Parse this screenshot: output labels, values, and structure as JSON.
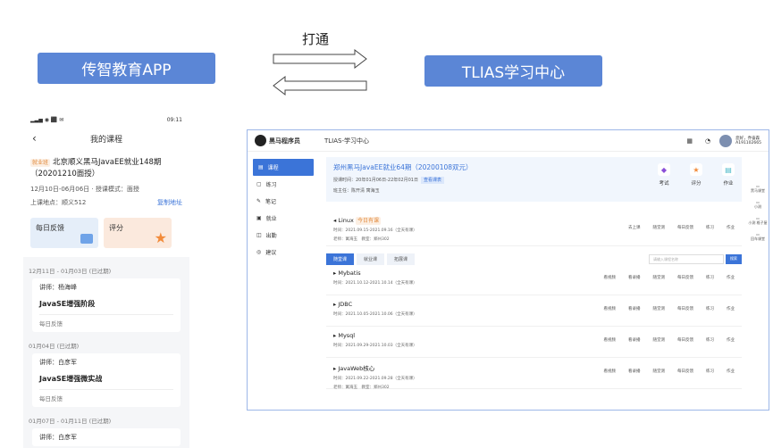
{
  "diagram": {
    "left_box": "传智教育APP",
    "right_box": "TLIAS学习中心",
    "arrow_label": "打通"
  },
  "phone": {
    "status_time": "09:11",
    "nav_title": "我的课程",
    "badge": "就业班",
    "course_title": "北京顺义黑马JavaEE就业148期（20201210面授）",
    "date_range": "12月10日-06月06日 · 授课模式：面授",
    "location": "上课地点：顺义512",
    "copy_link": "复制地址",
    "card1": "每日反馈",
    "card2": "评分",
    "sections": [
      {
        "date": "12月11日 - 01月03日 (已过期)",
        "teacher": "讲师：杨海峰",
        "name": "JavaSE增强阶段",
        "fb": "每日反馈"
      },
      {
        "date": "01月04日 (已过期)",
        "teacher": "讲师：白彦军",
        "name": "JavaSE增强微实战",
        "fb": "每日反馈"
      },
      {
        "date": "01月07日 - 01月11日 (已过期)",
        "teacher": "讲师：白彦军",
        "name": "",
        "fb": ""
      }
    ]
  },
  "web": {
    "logo": "黑马程序员",
    "title": "TLIAS-学习中心",
    "user": "您好，乔奋森",
    "user_id": "A191102665",
    "sidebar": [
      "课程",
      "练习",
      "笔记",
      "就业",
      "出勤",
      "建议"
    ],
    "hero": {
      "title": "郑州黑马JavaEE就业64期（20200108双元）",
      "time": "授课时间：20年01月06日-22年02月01日",
      "time_tag": "查看课表",
      "teacher": "班主任：陈开清 寓海玉",
      "acts": [
        "考试",
        "评分",
        "作业"
      ]
    },
    "linux": {
      "name": "Linux",
      "badge": "今日有课",
      "time": "时间：2021.09.15-2021.09.16（全天有课）",
      "teacher": "老师：寓海玉　教室：郑州302",
      "ops": [
        "去上课",
        "随堂测",
        "每日反馈",
        "练习",
        "作业"
      ]
    },
    "tabs": [
      "随堂课",
      "就业课",
      "拓展课"
    ],
    "search_placeholder": "请输入课程名称",
    "search_btn": "搜索",
    "courses": [
      {
        "name": "Mybatis",
        "time": "时间：2021.10.12-2021.10.14（全天有课）",
        "teacher": ""
      },
      {
        "name": "JDBC",
        "time": "时间：2021.10.05-2021.10.06（全天有课）",
        "teacher": ""
      },
      {
        "name": "Mysql",
        "time": "时间：2021.09.29-2021.10.03（全天有课）",
        "teacher": ""
      },
      {
        "name": "JavaWeb核心",
        "time": "时间：2021.09.22-2021.09.28（全天有课）",
        "teacher": "老师：寓海玉　教室：郑州302"
      }
    ],
    "course_ops": [
      "看视频",
      "看录播",
      "随堂测",
      "每日反馈",
      "练习",
      "作业"
    ],
    "right_tools": [
      "黑马课堂",
      "小测",
      "小测\n格子屋",
      "回车课堂"
    ]
  }
}
